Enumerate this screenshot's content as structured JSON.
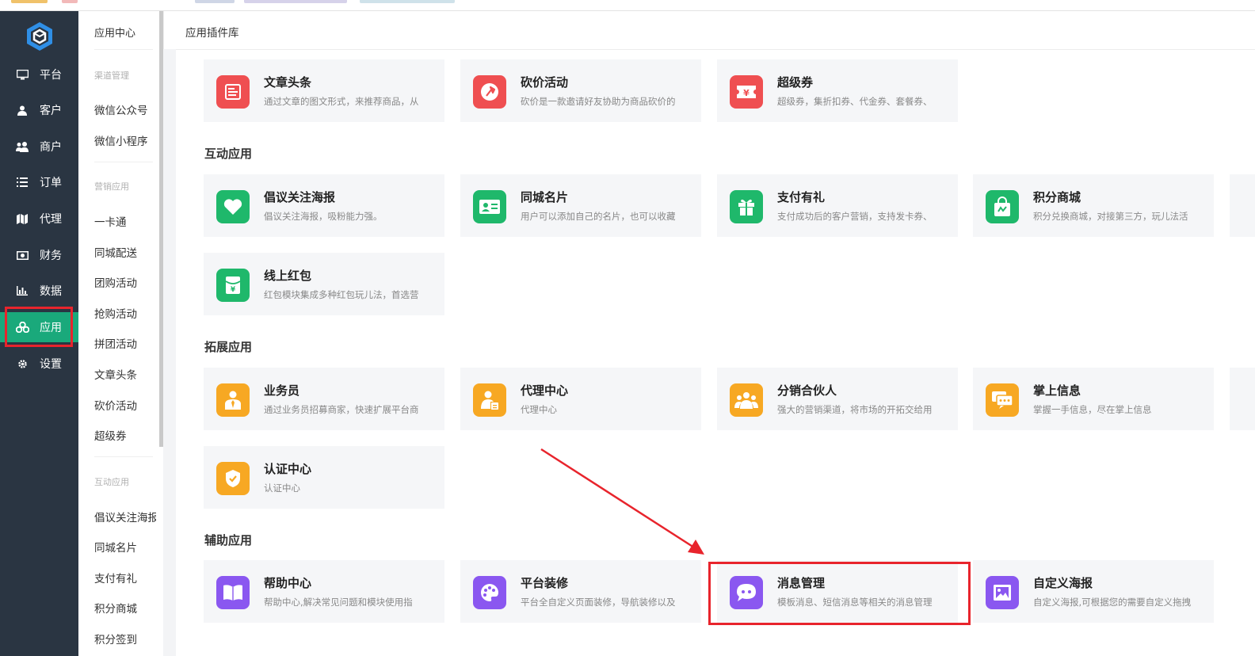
{
  "nav": {
    "items": [
      {
        "label": "平台",
        "icon": "monitor-icon"
      },
      {
        "label": "客户",
        "icon": "user-icon"
      },
      {
        "label": "商户",
        "icon": "users-icon"
      },
      {
        "label": "订单",
        "icon": "list-icon"
      },
      {
        "label": "代理",
        "icon": "map-icon"
      },
      {
        "label": "财务",
        "icon": "money-icon"
      },
      {
        "label": "数据",
        "icon": "bar-chart-icon"
      },
      {
        "label": "应用",
        "icon": "apps-icon",
        "active": true
      },
      {
        "label": "设置",
        "icon": "gear-icon"
      }
    ]
  },
  "subnav": {
    "title": "应用中心",
    "groups": [
      {
        "label": "渠道管理",
        "items": [
          "微信公众号",
          "微信小程序"
        ]
      },
      {
        "label": "营销应用",
        "items": [
          "一卡通",
          "同城配送",
          "团购活动",
          "抢购活动",
          "拼团活动",
          "文章头条",
          "砍价活动",
          "超级券"
        ]
      },
      {
        "label": "互动应用",
        "items": [
          "倡议关注海报",
          "同城名片",
          "支付有礼",
          "积分商城",
          "积分签到"
        ]
      }
    ]
  },
  "main": {
    "breadcrumb": "应用插件库",
    "sections": [
      {
        "title": "",
        "cards": [
          {
            "name": "文章头条",
            "desc": "通过文章的图文形式，来推荐商品，从",
            "color": "#ef4f51",
            "icon": "article-icon"
          },
          {
            "name": "砍价活动",
            "desc": "砍价是一款邀请好友协助为商品砍价的",
            "color": "#ef4f51",
            "icon": "axe-icon"
          },
          {
            "name": "超级券",
            "desc": "超级券，集折扣券、代金券、套餐券、",
            "color": "#ef4f51",
            "icon": "coupon-icon"
          }
        ]
      },
      {
        "title": "互动应用",
        "cards": [
          {
            "name": "倡议关注海报",
            "desc": "倡议关注海报，吸粉能力强。",
            "color": "#1fb86b",
            "icon": "heart-icon"
          },
          {
            "name": "同城名片",
            "desc": "用户可以添加自己的名片，也可以收藏",
            "color": "#1fb86b",
            "icon": "id-card-icon"
          },
          {
            "name": "支付有礼",
            "desc": "支付成功后的客户营销，支持发卡券、",
            "color": "#1fb86b",
            "icon": "gift-icon"
          },
          {
            "name": "积分商城",
            "desc": "积分兑换商城，对接第三方，玩儿法活",
            "color": "#1fb86b",
            "icon": "shopping-bag-icon"
          },
          {
            "name": "线上红包",
            "desc": "红包模块集成多种红包玩儿法，首选营",
            "color": "#1fb86b",
            "icon": "red-packet-icon"
          }
        ]
      },
      {
        "title": "拓展应用",
        "cards": [
          {
            "name": "业务员",
            "desc": "通过业务员招募商家，快速扩展平台商",
            "color": "#f7a823",
            "icon": "salesman-icon"
          },
          {
            "name": "代理中心",
            "desc": "代理中心",
            "color": "#f7a823",
            "icon": "agent-icon"
          },
          {
            "name": "分销合伙人",
            "desc": "强大的营销渠道，将市场的开拓交给用",
            "color": "#f7a823",
            "icon": "partners-icon"
          },
          {
            "name": "掌上信息",
            "desc": "掌握一手信息，尽在掌上信息",
            "color": "#f7a823",
            "icon": "chat-icon"
          },
          {
            "name": "认证中心",
            "desc": "认证中心",
            "color": "#f7a823",
            "icon": "shield-icon"
          }
        ]
      },
      {
        "title": "辅助应用",
        "cards": [
          {
            "name": "帮助中心",
            "desc": "帮助中心,解决常见问题和模块使用指",
            "color": "#8a57f0",
            "icon": "book-icon"
          },
          {
            "name": "平台装修",
            "desc": "平台全自定义页面装修，导航装修以及",
            "color": "#8a57f0",
            "icon": "palette-icon"
          },
          {
            "name": "消息管理",
            "desc": "模板消息、短信消息等相关的消息管理",
            "color": "#8a57f0",
            "icon": "message-icon"
          },
          {
            "name": "自定义海报",
            "desc": "自定义海报,可根据您的需要自定义拖拽",
            "color": "#8a57f0",
            "icon": "image-icon"
          }
        ]
      }
    ]
  }
}
